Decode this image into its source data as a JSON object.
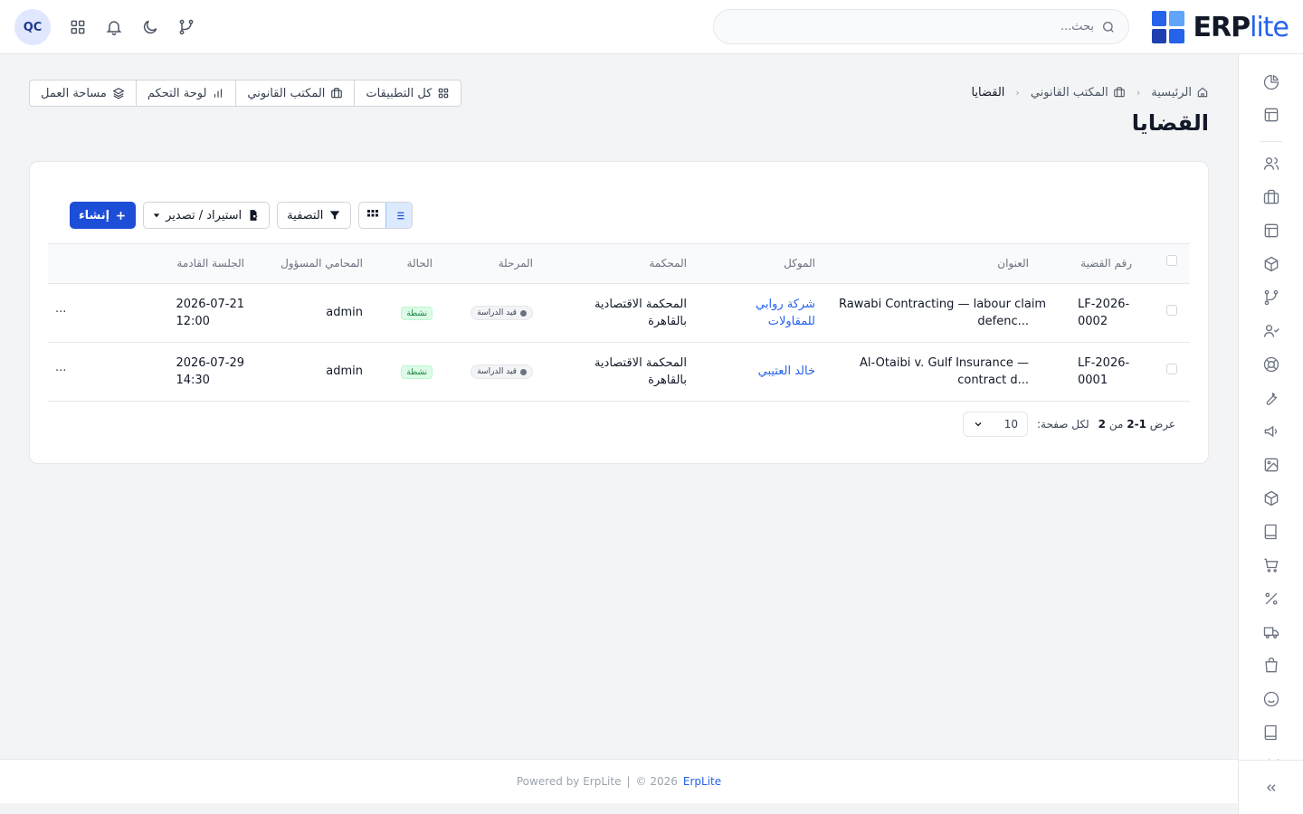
{
  "header": {
    "brand_erp": "ERP",
    "brand_lite": "lite",
    "search_placeholder": "بحث...",
    "avatar_initials": "QC"
  },
  "colors": {
    "primary": "#1d4ed8",
    "link": "#2563eb",
    "logo_blue": "#2563eb",
    "logo_dark": "#1e40af",
    "status_green_bg": "#dcfce7",
    "status_green_text": "#15803d"
  },
  "breadcrumb": {
    "home": "الرئيسية",
    "section": "المكتب القانوني",
    "current": "القضايا"
  },
  "page_title": "القضايا",
  "quicklinks": [
    {
      "label": "كل التطبيقات",
      "icon": "grid-icon"
    },
    {
      "label": "المكتب القانوني",
      "icon": "briefcase-icon"
    },
    {
      "label": "لوحة التحكم",
      "icon": "bar-chart-icon"
    },
    {
      "label": "مساحة العمل",
      "icon": "layers-icon"
    }
  ],
  "toolbar": {
    "create_label": "إنشاء",
    "import_export_label": "استيراد / تصدير",
    "filter_label": "التصفية"
  },
  "table": {
    "columns": {
      "case_number": "رقم القضية",
      "title": "العنوان",
      "client": "الموكل",
      "court": "المحكمة",
      "stage": "المرحلة",
      "status": "الحالة",
      "lawyer": "المحامي المسؤول",
      "next_session": "الجلسة القادمة"
    },
    "rows": [
      {
        "case_number_line1": "LF-2026-",
        "case_number_line2": "0002",
        "title_line1": "Rawabi Contracting — labour claim",
        "title_line2": "defenc...",
        "client_line1": "شركة روابي",
        "client_line2": "للمقاولات",
        "court_line1": "المحكمة الاقتصادية",
        "court_line2": "بالقاهرة",
        "stage": "قيد الدراسة",
        "status": "نشطة",
        "lawyer": "admin",
        "next_date": "2026-07-21",
        "next_time": "12:00",
        "more": "..."
      },
      {
        "case_number_line1": "LF-2026-",
        "case_number_line2": "0001",
        "title_line1": "Al-Otaibi v. Gulf Insurance —",
        "title_line2": "contract d...",
        "client_line1": "خالد العتيبي",
        "client_line2": "",
        "court_line1": "المحكمة الاقتصادية",
        "court_line2": "بالقاهرة",
        "stage": "قيد الدراسة",
        "status": "نشطة",
        "lawyer": "admin",
        "next_date": "2026-07-29",
        "next_time": "14:30",
        "more": "..."
      }
    ]
  },
  "pagination": {
    "showing_prefix": "عرض",
    "range": "1-2",
    "of_word": "من",
    "total": "2",
    "per_page_label": "لكل صفحة:",
    "per_page_value": "10"
  },
  "footer": {
    "powered_by": "Powered by ErpLite",
    "separator": "|",
    "copyright": "2026 ©",
    "brand_link": "ErpLite"
  },
  "rail_icons": [
    "pie-chart-icon",
    "layout-icon",
    "users-icon",
    "briefcase-icon",
    "layout-icon",
    "box-icon",
    "git-branch-icon",
    "user-check-icon",
    "lifebuoy-icon",
    "wrench-icon",
    "megaphone-icon",
    "image-icon",
    "package-icon",
    "book-icon",
    "cart-icon",
    "percent-icon",
    "truck-icon",
    "shopping-bag-icon",
    "smile-icon",
    "book-icon",
    "map-icon"
  ]
}
